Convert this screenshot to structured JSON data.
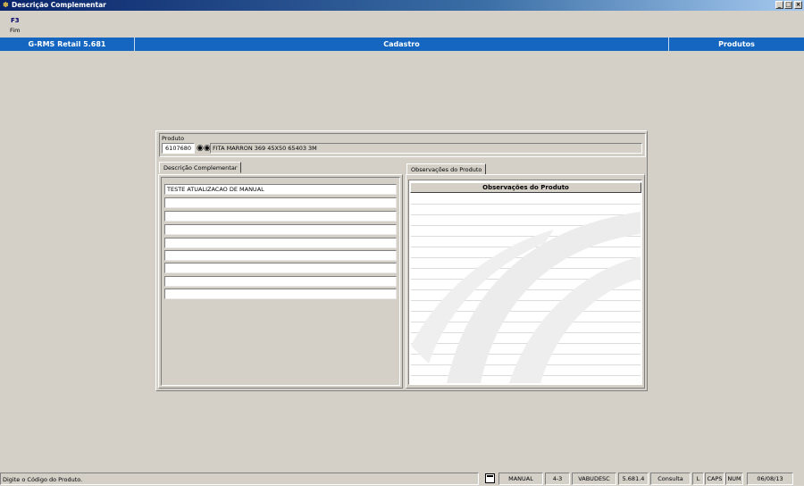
{
  "window": {
    "title": "Descrição Complementar"
  },
  "shortcut": {
    "key": "F3",
    "label": "Fim"
  },
  "header": {
    "app": "G-RMS Retail 5.681",
    "module": "Cadastro",
    "section": "Produtos"
  },
  "produto": {
    "label": "Produto",
    "code": "6107680",
    "description": "FITA MARRON 369 45X50 65403 3M"
  },
  "tabs": {
    "left": "Descrição Complementar",
    "right": "Observações do Produto"
  },
  "descricao_lines": [
    "TESTE ATUALIZACAO DE MANUAL",
    "",
    "",
    "",
    "",
    "",
    "",
    "",
    ""
  ],
  "observacoes": {
    "header": "Observações do Produto"
  },
  "status": {
    "message": "Digite o Código do Produto.",
    "mode": "MANUAL",
    "version_code": "4-3",
    "program": "VABUDESC",
    "build": "5.681.4",
    "operation": "Consulta",
    "l": "L",
    "caps": "CAPS",
    "num": "NUM",
    "date": "06/08/13"
  },
  "colors": {
    "header_blue": "#1566c0",
    "title_blue": "#0a246a",
    "face": "#d4d0c8"
  }
}
